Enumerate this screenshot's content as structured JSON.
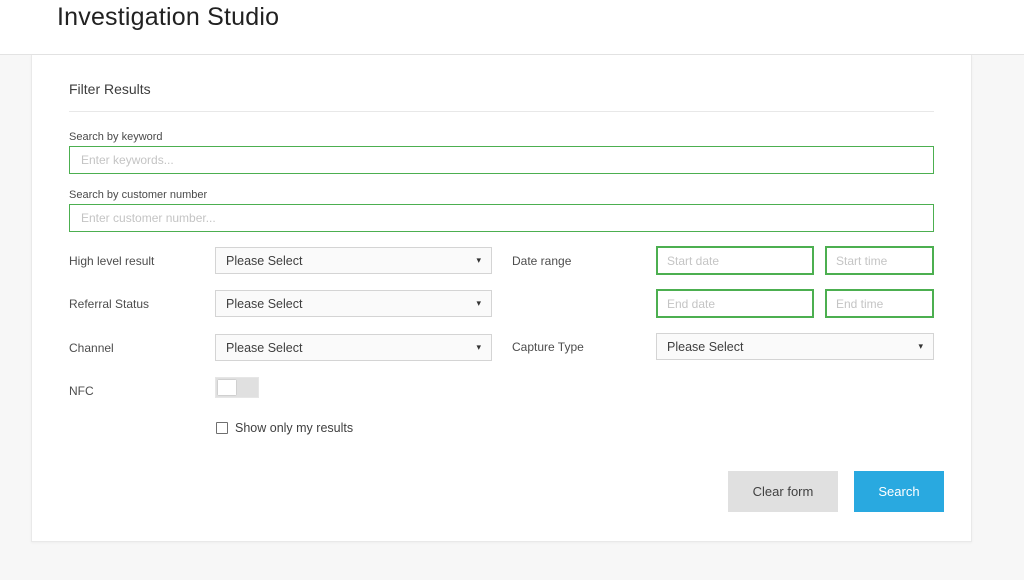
{
  "header": {
    "title": "Investigation Studio"
  },
  "panel": {
    "title": "Filter Results",
    "keyword": {
      "label": "Search by keyword",
      "placeholder": "Enter keywords...",
      "value": ""
    },
    "customer": {
      "label": "Search by customer number",
      "placeholder": "Enter customer number...",
      "value": ""
    },
    "high_level_result": {
      "label": "High level result",
      "selected": "Please Select"
    },
    "referral_status": {
      "label": "Referral Status",
      "selected": "Please Select"
    },
    "channel": {
      "label": "Channel",
      "selected": "Please Select"
    },
    "capture_type": {
      "label": "Capture Type",
      "selected": "Please Select"
    },
    "date_range": {
      "label": "Date range",
      "start_date_placeholder": "Start date",
      "start_time_placeholder": "Start time",
      "end_date_placeholder": "End date",
      "end_time_placeholder": "End time"
    },
    "nfc": {
      "label": "NFC",
      "state": "off"
    },
    "show_only_my_results": {
      "label": "Show only my results",
      "checked": false
    },
    "buttons": {
      "clear": "Clear form",
      "search": "Search"
    }
  },
  "icons": {
    "select_caret": "caret-down-icon"
  },
  "colors": {
    "accent_green": "#4caf50",
    "accent_blue": "#29a9e0",
    "page_bg": "#f7f7f7",
    "select_bg": "#fafafa",
    "select_border": "#d4d4d4",
    "clear_btn_bg": "#e0e0e0"
  }
}
